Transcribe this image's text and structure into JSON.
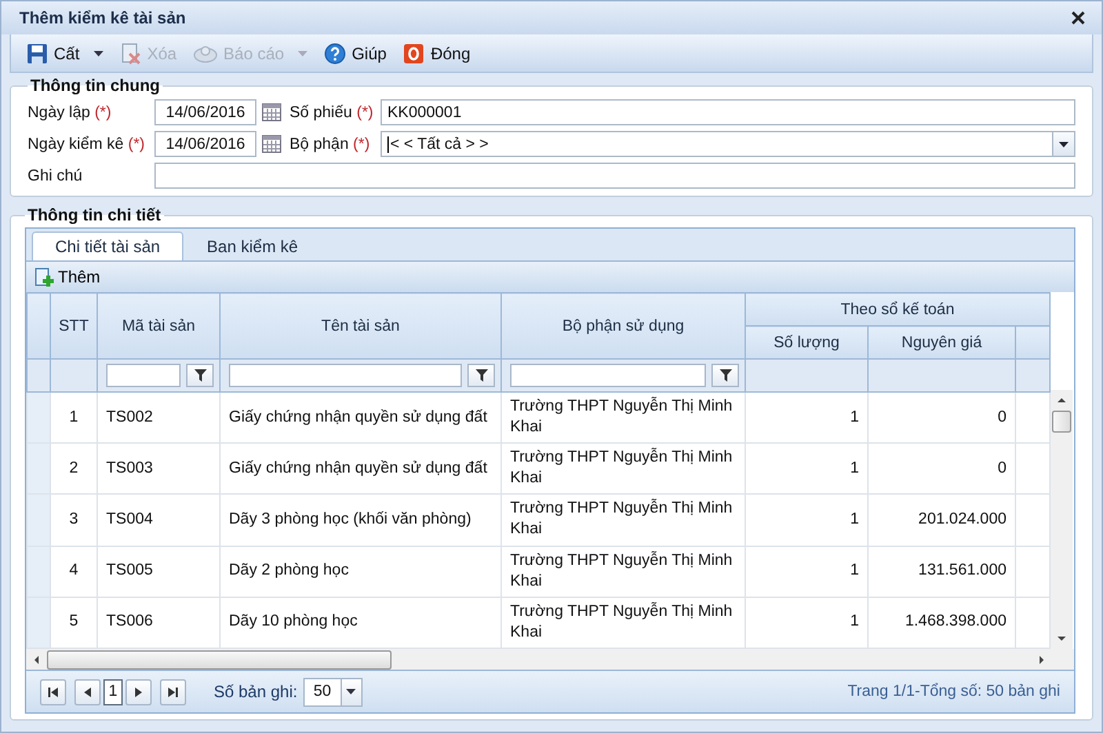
{
  "window": {
    "title": "Thêm kiểm kê tài sản"
  },
  "toolbar": [
    {
      "kind": "save",
      "label": "Cất",
      "disabled": false,
      "dropdown": true
    },
    {
      "kind": "delete",
      "label": "Xóa",
      "disabled": true,
      "dropdown": false
    },
    {
      "kind": "report",
      "label": "Báo cáo",
      "disabled": true,
      "dropdown": true
    },
    {
      "kind": "help",
      "label": "Giúp",
      "disabled": false,
      "dropdown": false
    },
    {
      "kind": "close",
      "label": "Đóng",
      "disabled": false,
      "dropdown": false
    }
  ],
  "general": {
    "title": "Thông tin chung",
    "created_date": {
      "label": "Ngày lập",
      "required_mark": "(*)",
      "value": "14/06/2016"
    },
    "voucher_no": {
      "label": "Số phiếu",
      "required_mark": "(*)",
      "value": "KK000001"
    },
    "check_date": {
      "label": "Ngày kiểm kê",
      "required_mark": "(*)",
      "value": "14/06/2016"
    },
    "department": {
      "label": "Bộ phận",
      "required_mark": "(*)",
      "value": "< < Tất cả > >"
    },
    "note": {
      "label": "Ghi chú"
    }
  },
  "detail": {
    "title": "Thông tin chi tiết",
    "tabs": [
      {
        "label": "Chi tiết tài sản",
        "selected": true
      },
      {
        "label": "Ban kiểm kê",
        "selected": false
      }
    ],
    "add_button": "Thêm",
    "table": {
      "group_header": "Theo sổ kế toán",
      "columns": [
        {
          "label": "STT",
          "kind": "center",
          "filter": false,
          "grouped": false
        },
        {
          "label": "Mã tài sản",
          "kind": "text",
          "filter": true,
          "grouped": false
        },
        {
          "label": "Tên tài sản",
          "kind": "text",
          "filter": true,
          "grouped": false
        },
        {
          "label": "Bộ phận sử dụng",
          "kind": "text",
          "filter": true,
          "grouped": false
        },
        {
          "label": "Số lượng",
          "kind": "number",
          "filter": false,
          "grouped": true
        },
        {
          "label": "Nguyên giá",
          "kind": "number",
          "filter": false,
          "grouped": true
        }
      ],
      "rows": [
        [
          "1",
          "TS002",
          "Giấy chứng nhận quyền sử dụng đất",
          "Trường THPT Nguyễn Thị Minh Khai",
          "1",
          "0"
        ],
        [
          "2",
          "TS003",
          "Giấy chứng nhận quyền sử dụng đất",
          "Trường THPT Nguyễn Thị Minh Khai",
          "1",
          "0"
        ],
        [
          "3",
          "TS004",
          "Dãy 3 phòng học (khối văn phòng)",
          "Trường THPT Nguyễn Thị Minh Khai",
          "1",
          "201.024.000"
        ],
        [
          "4",
          "TS005",
          "Dãy 2 phòng học",
          "Trường THPT Nguyễn Thị Minh Khai",
          "1",
          "131.561.000"
        ],
        [
          "5",
          "TS006",
          "Dãy 10 phòng học",
          "Trường THPT Nguyễn Thị Minh Khai",
          "1",
          "1.468.398.000"
        ]
      ]
    },
    "pager": {
      "page": "1",
      "page_size_label": "Số bản ghi:",
      "page_size": "50",
      "summary": "Trang 1/1-Tổng số: 50 bản ghi"
    }
  }
}
